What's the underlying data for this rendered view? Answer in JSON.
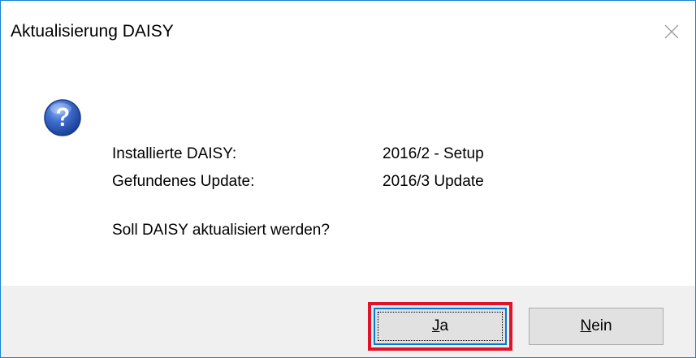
{
  "window": {
    "title": "Aktualisierung DAISY",
    "close_label": "×"
  },
  "message": {
    "icon": "question-icon",
    "installed_label": "Installierte DAISY:",
    "installed_value": "2016/2 - Setup",
    "found_label": "Gefundenes Update:",
    "found_value": "2016/3 Update",
    "question": "Soll DAISY aktualisiert werden?"
  },
  "buttons": {
    "yes": {
      "mnemonic": "J",
      "rest": "a"
    },
    "no": {
      "mnemonic": "N",
      "rest": "ein"
    }
  },
  "colors": {
    "window_border": "#1883d7",
    "footer_bg": "#f0f0f0",
    "highlight": "#e2122a",
    "button_focus": "#0078d7"
  }
}
